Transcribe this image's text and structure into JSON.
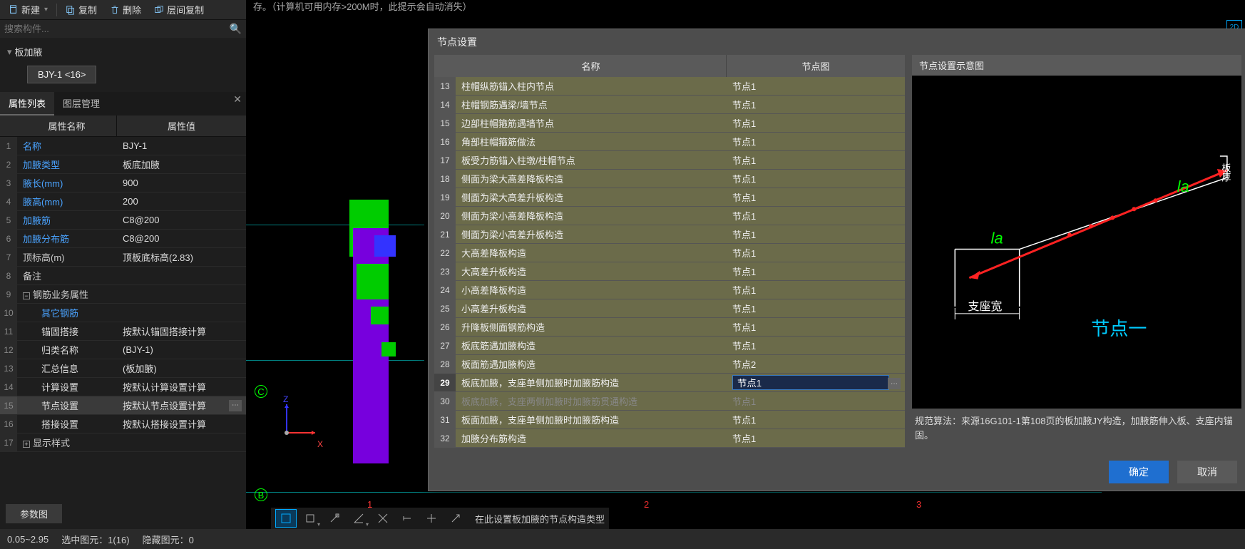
{
  "toolbar": {
    "new": "新建",
    "copy": "复制",
    "delete": "删除",
    "layer_copy": "层间复制"
  },
  "search": {
    "placeholder": "搜索构件..."
  },
  "tree": {
    "root": "板加腋",
    "child": "BJY-1 <16>"
  },
  "tabs": {
    "props": "属性列表",
    "layers": "图层管理"
  },
  "prop_header": {
    "name": "属性名称",
    "value": "属性值"
  },
  "props": [
    {
      "n": "1",
      "name": "名称",
      "val": "BJY-1",
      "link": true
    },
    {
      "n": "2",
      "name": "加腋类型",
      "val": "板底加腋",
      "link": true
    },
    {
      "n": "3",
      "name": "腋长(mm)",
      "val": "900",
      "link": true
    },
    {
      "n": "4",
      "name": "腋高(mm)",
      "val": "200",
      "link": true
    },
    {
      "n": "5",
      "name": "加腋筋",
      "val": "C8@200",
      "link": true
    },
    {
      "n": "6",
      "name": "加腋分布筋",
      "val": "C8@200",
      "link": true
    },
    {
      "n": "7",
      "name": "顶标高(m)",
      "val": "顶板底标高(2.83)"
    },
    {
      "n": "8",
      "name": "备注",
      "val": ""
    },
    {
      "n": "9",
      "name": "钢筋业务属性",
      "val": "",
      "group": true
    },
    {
      "n": "10",
      "name": "其它钢筋",
      "val": "",
      "sub": true,
      "link": true
    },
    {
      "n": "11",
      "name": "锚固搭接",
      "val": "按默认锚固搭接计算",
      "sub": true
    },
    {
      "n": "12",
      "name": "归类名称",
      "val": "(BJY-1)",
      "sub": true
    },
    {
      "n": "13",
      "name": "汇总信息",
      "val": "(板加腋)",
      "sub": true
    },
    {
      "n": "14",
      "name": "计算设置",
      "val": "按默认计算设置计算",
      "sub": true
    },
    {
      "n": "15",
      "name": "节点设置",
      "val": "按默认节点设置计算",
      "sub": true,
      "active": true,
      "dots": true
    },
    {
      "n": "16",
      "name": "搭接设置",
      "val": "按默认搭接设置计算",
      "sub": true
    },
    {
      "n": "17",
      "name": "显示样式",
      "val": "",
      "group": true,
      "plus": true
    }
  ],
  "param_btn": "参数图",
  "banner_line2": "存。（计算机可用内存>200M时，此提示会自动消失）",
  "dialog": {
    "title": "节点设置",
    "col_name": "名称",
    "col_img": "节点图",
    "rows": [
      {
        "n": "13",
        "name": "柱帽纵筋锚入柱内节点",
        "img": "节点1"
      },
      {
        "n": "14",
        "name": "柱帽钢筋遇梁/墙节点",
        "img": "节点1"
      },
      {
        "n": "15",
        "name": "边部柱帽箍筋遇墙节点",
        "img": "节点1"
      },
      {
        "n": "16",
        "name": "角部柱帽箍筋做法",
        "img": "节点1"
      },
      {
        "n": "17",
        "name": "板受力筋锚入柱墩/柱帽节点",
        "img": "节点1"
      },
      {
        "n": "18",
        "name": "侧面为梁大高差降板构造",
        "img": "节点1"
      },
      {
        "n": "19",
        "name": "侧面为梁大高差升板构造",
        "img": "节点1"
      },
      {
        "n": "20",
        "name": "侧面为梁小高差降板构造",
        "img": "节点1"
      },
      {
        "n": "21",
        "name": "侧面为梁小高差升板构造",
        "img": "节点1"
      },
      {
        "n": "22",
        "name": "大高差降板构造",
        "img": "节点1"
      },
      {
        "n": "23",
        "name": "大高差升板构造",
        "img": "节点1"
      },
      {
        "n": "24",
        "name": "小高差降板构造",
        "img": "节点1"
      },
      {
        "n": "25",
        "name": "小高差升板构造",
        "img": "节点1"
      },
      {
        "n": "26",
        "name": "升降板侧面钢筋构造",
        "img": "节点1"
      },
      {
        "n": "27",
        "name": "板底筋遇加腋构造",
        "img": "节点1"
      },
      {
        "n": "28",
        "name": "板面筋遇加腋构造",
        "img": "节点2"
      },
      {
        "n": "29",
        "name": "板底加腋，支座单侧加腋时加腋筋构造",
        "img": "节点1",
        "selected": true
      },
      {
        "n": "30",
        "name": "板底加腋，支座两侧加腋时加腋筋贯通构造",
        "img": "节点1",
        "disabled": true
      },
      {
        "n": "31",
        "name": "板面加腋，支座单侧加腋时加腋筋构造",
        "img": "节点1"
      },
      {
        "n": "32",
        "name": "加腋分布筋构造",
        "img": "节点1"
      }
    ],
    "right_title": "节点设置示意图",
    "desc": "规范算法：来源16G101-1第108页的板加腋JY构造，加腋筋伸入板、支座内锚固。",
    "diagram": {
      "la1": "la",
      "la2": "la",
      "seat": "支座宽",
      "node": "节点一"
    },
    "ok": "确定",
    "cancel": "取消"
  },
  "status": {
    "range": "0.05~2.95",
    "selected": "选中图元：1(16)",
    "hidden": "隐藏图元：0"
  },
  "bottom_hint": "在此设置板加腋的节点构造类型",
  "axis": {
    "x": "X",
    "z": "Z"
  },
  "grid": {
    "b": "B",
    "c": "C",
    "n1": "1",
    "n2": "2",
    "n3": "3"
  }
}
